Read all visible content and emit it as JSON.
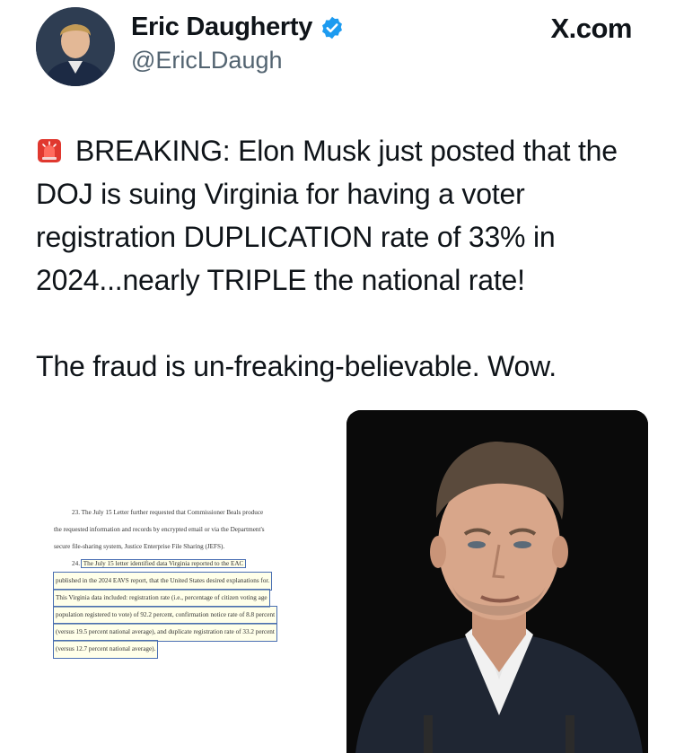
{
  "author": {
    "display_name": "Eric Daugherty",
    "handle": "@EricLDaugh",
    "verified": true,
    "avatar_icon": "profile-photo"
  },
  "site_label": "X.com",
  "tweet": {
    "paragraph1": "BREAKING: Elon Musk just posted that the DOJ is suing Virginia for having a voter registration DUPLICATION rate of 33% in 2024...nearly TRIPLE the national rate!",
    "paragraph2": "The fraud is un-freaking-believable. Wow.",
    "leading_icon": "siren-emoji"
  },
  "document": {
    "line1": "23.   The July 15 Letter further requested that Commissioner Beals produce",
    "line2": "the requested information and records by encrypted email or via the Department's",
    "line3": "secure file-sharing system, Justice Enterprise File Sharing (JEFS).",
    "line4_num": "24.",
    "line4": "The July 15 letter identified data Virginia reported to the EAC",
    "line5": "published in the 2024 EAVS report, that the United States desired explanations for.",
    "line6": "This Virginia data included: registration rate (i.e., percentage of citizen voting age",
    "line7": "population registered to vote) of 92.2 percent, confirmation notice rate of 8.8 percent",
    "line8": "(versus 19.5 percent national average), and duplicate registration rate of 33.2 percent",
    "line9": "(versus 12.7 percent national average)."
  },
  "colors": {
    "verified_blue": "#1d9bf0",
    "text": "#0f1419",
    "handle_gray": "#536471",
    "highlight_border": "#4a6fb3"
  }
}
